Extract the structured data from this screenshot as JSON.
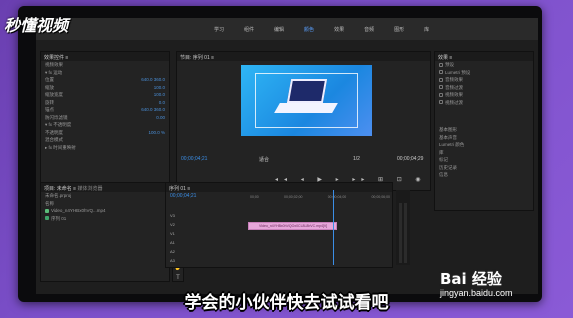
{
  "watermark": {
    "logo": "秒懂视频",
    "baidu": "Bai 经验",
    "baidu_url": "jingyan.baidu.com"
  },
  "caption": "学会的小伙伴快去试试看吧",
  "menu": {
    "tabs": [
      "学习",
      "组件",
      "编辑",
      "颜色",
      "效果",
      "音频",
      "图形",
      "库"
    ],
    "active_index": 3
  },
  "effect_controls": {
    "title": "效果控件 ≡",
    "rows": [
      "视频效果",
      "▾ fx 运动",
      "位置",
      "缩放",
      "缩放宽度",
      "旋转",
      "锚点",
      "防闪烁滤镜",
      "▾ fx 不透明度",
      "不透明度",
      "混合模式",
      "▸ fx 时间重映射"
    ],
    "values": [
      "640.0  360.0",
      "100.0",
      "100.0",
      "0.0",
      "640.0  360.0",
      "0.00",
      "100.0 %"
    ]
  },
  "program": {
    "title": "节目: 序列 01 ≡",
    "timecode_left": "00;00;04;21",
    "fit": "适合",
    "ratio": "1/2",
    "timecode_right": "00;00;04;29"
  },
  "effects_panel": {
    "title": "效果 ≡",
    "items": [
      "预设",
      "Lumetri 预设",
      "音频效果",
      "音频过渡",
      "视频效果",
      "视频过渡"
    ],
    "sections": [
      "基本图形",
      "基本声音",
      "Lumetri 颜色",
      "库",
      "标记",
      "历史记录",
      "信息"
    ]
  },
  "project": {
    "title": "项目: 未命名 ≡",
    "subtitle": "媒体浏览器",
    "file": "未命名.prproj",
    "header": "名称",
    "items": [
      "Video_n4YHBx0hVQ...mp4",
      "序列 01"
    ]
  },
  "timeline": {
    "title": "序列 01 ≡",
    "timecode": "00;00;04;21",
    "ruler": [
      "00;00",
      "00;00;02;00",
      "00;00;04;00",
      "00;00;06;00"
    ],
    "tracks": [
      "V3",
      "V2",
      "V1",
      "A1",
      "A2",
      "A3"
    ],
    "clip_label": "Video_n4YHBx0hVQOx0CL8L8bVC.mp4[V]"
  }
}
